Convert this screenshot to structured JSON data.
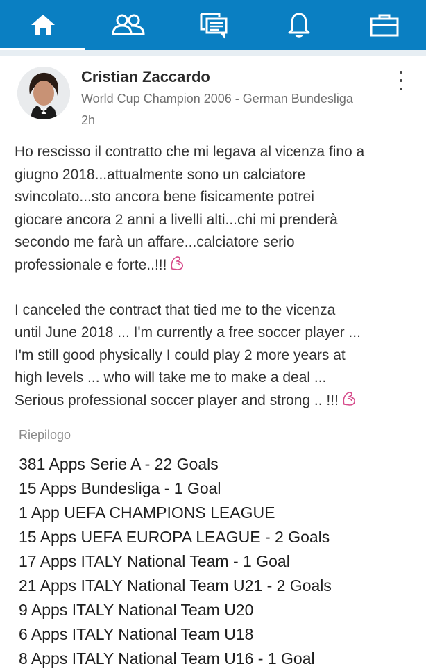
{
  "nav": {
    "items": [
      {
        "name": "home",
        "icon": "home-icon",
        "active": true
      },
      {
        "name": "network",
        "icon": "people-icon",
        "active": false
      },
      {
        "name": "messages",
        "icon": "messages-icon",
        "active": false
      },
      {
        "name": "notifications",
        "icon": "bell-icon",
        "active": false
      },
      {
        "name": "jobs",
        "icon": "briefcase-icon",
        "active": false
      }
    ],
    "colors": {
      "bar": "#0a7fc2",
      "icon": "#ffffff"
    }
  },
  "post": {
    "author_name": "Cristian Zaccardo",
    "author_headline": "World Cup Champion 2006 - German Bundesliga",
    "time": "2h",
    "lines_it": [
      "Ho rescisso il contratto che mi legava al vicenza fino a",
      "giugno 2018...attualmente sono un calciatore",
      "svincolato...sto ancora bene fisicamente potrei",
      "giocare ancora 2 anni a livelli alti...chi mi prenderà",
      "secondo me farà un affare...calciatore serio",
      "professionale e forte..!!!"
    ],
    "lines_en": [
      "I canceled the contract that tied me to the vicenza",
      "until June 2018 ... I'm currently a free soccer player ...",
      "I'm still good physically I could play 2 more years at",
      "high levels ... who will take me to make a deal ...",
      "Serious professional soccer player and strong .. !!!"
    ],
    "emoji_icon": "flexed-biceps-icon",
    "emoji_color": "#d64a8a"
  },
  "summary": {
    "label": "Riepilogo",
    "items": [
      "381 Apps Serie A -  22 Goals",
      "15 Apps Bundesliga - 1 Goal",
      "1 App UEFA CHAMPIONS LEAGUE",
      "15 Apps UEFA EUROPA LEAGUE - 2 Goals",
      "17 Apps ITALY National Team - 1 Goal",
      "21 Apps ITALY National Team U21 - 2 Goals",
      "9 Apps ITALY National Team U20",
      "6 Apps ITALY National Team U18",
      "8 Apps ITALY National Team U16 - 1 Goal"
    ]
  }
}
